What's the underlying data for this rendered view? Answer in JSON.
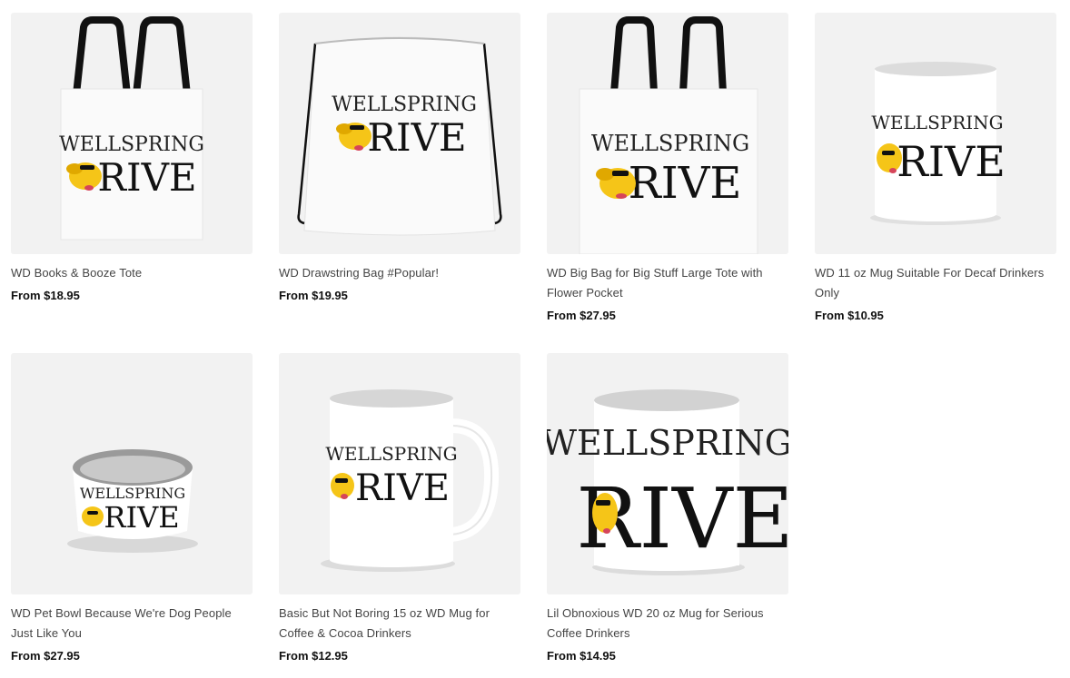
{
  "brand": {
    "line1": "WELLSPRING",
    "line2": "RIVE"
  },
  "products": [
    {
      "title": "WD Books & Booze Tote",
      "price": "From $18.95",
      "kind": "tote"
    },
    {
      "title": "WD Drawstring Bag #Popular!",
      "price": "From $19.95",
      "kind": "drawstring"
    },
    {
      "title": "WD Big Bag for Big Stuff Large Tote with Flower Pocket",
      "price": "From $27.95",
      "kind": "big-tote"
    },
    {
      "title": "WD 11 oz Mug Suitable For Decaf Drinkers Only",
      "price": "From $10.95",
      "kind": "mug-11oz"
    },
    {
      "title": "WD Pet Bowl Because We're Dog People Just Like You",
      "price": "From $27.95",
      "kind": "pet-bowl"
    },
    {
      "title": "Basic But Not Boring 15 oz WD Mug for Coffee & Cocoa Drinkers",
      "price": "From $12.95",
      "kind": "mug-15oz"
    },
    {
      "title": "Lil Obnoxious WD 20 oz Mug for Serious Coffee Drinkers",
      "price": "From $14.95",
      "kind": "mug-20oz"
    }
  ],
  "colors": {
    "thumb_bg": "#f2f2f2",
    "dog": "#f5c518",
    "price": "#111111"
  }
}
